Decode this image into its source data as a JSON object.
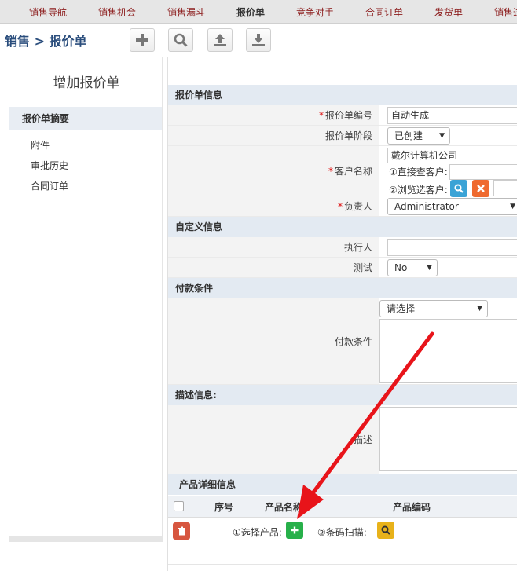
{
  "topnav": [
    "销售导航",
    "销售机会",
    "销售漏斗",
    "报价单",
    "竞争对手",
    "合同订单",
    "发货单",
    "销售过"
  ],
  "breadcrumb": "销售 > 报价单",
  "toolbar": {
    "add_icon": "plus-icon",
    "search_icon": "search-icon",
    "upload_icon": "upload-icon",
    "download_icon": "download-icon"
  },
  "sidebar": {
    "title": "增加报价单",
    "summary": "报价单摘要",
    "links": [
      "附件",
      "审批历史",
      "合同订单"
    ]
  },
  "sections": {
    "quote_info": "报价单信息",
    "custom_info": "自定义信息",
    "payment": "付款条件",
    "description": "描述信息:",
    "product_details": "产品详细信息"
  },
  "fields": {
    "quote_no_label": "报价单编号",
    "quote_no_value": "自动生成",
    "stage_label": "报价单阶段",
    "stage_value": "已创建",
    "customer_label": "客户名称",
    "customer_value": "戴尔计算机公司",
    "direct_lookup": "①直接查客户:",
    "browse_select": "②浏览选客户:",
    "owner_label": "负责人",
    "owner_value": "Administrator",
    "executor_label": "执行人",
    "test_label": "测试",
    "test_value": "No",
    "payment_label": "付款条件",
    "payment_value": "请选择",
    "description_label": "描述"
  },
  "table": {
    "columns": [
      "序号",
      "产品名称",
      "产品编码"
    ],
    "select_product": "①选择产品:",
    "barcode_scan": "②条码扫描:"
  },
  "colors": {
    "accent_red": "#8b1a1a",
    "blue_btn": "#3aa3d6",
    "orange_btn": "#ef6a2f",
    "green_btn": "#27b04a",
    "yellow_btn": "#e8b21a",
    "delete_btn": "#d7563f",
    "arrow": "#e8141a"
  }
}
